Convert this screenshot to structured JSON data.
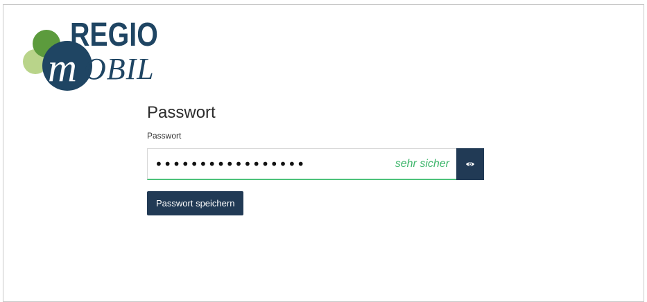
{
  "logo": {
    "top_word": "REGIO",
    "bottom_m": "m",
    "bottom_word": "OBIL",
    "colors": {
      "navy": "#1f4563",
      "green_dark": "#5a9a3c",
      "green_light": "#a9c97a"
    }
  },
  "form": {
    "title": "Passwort",
    "field_label": "Passwort",
    "password_value": "•••••••••••••••••",
    "strength_text": "sehr sicher",
    "show_password_icon": "eye-icon",
    "save_label": "Passwort speichern"
  },
  "colors": {
    "accent": "#213a55",
    "strength_green": "#3fb66c"
  }
}
